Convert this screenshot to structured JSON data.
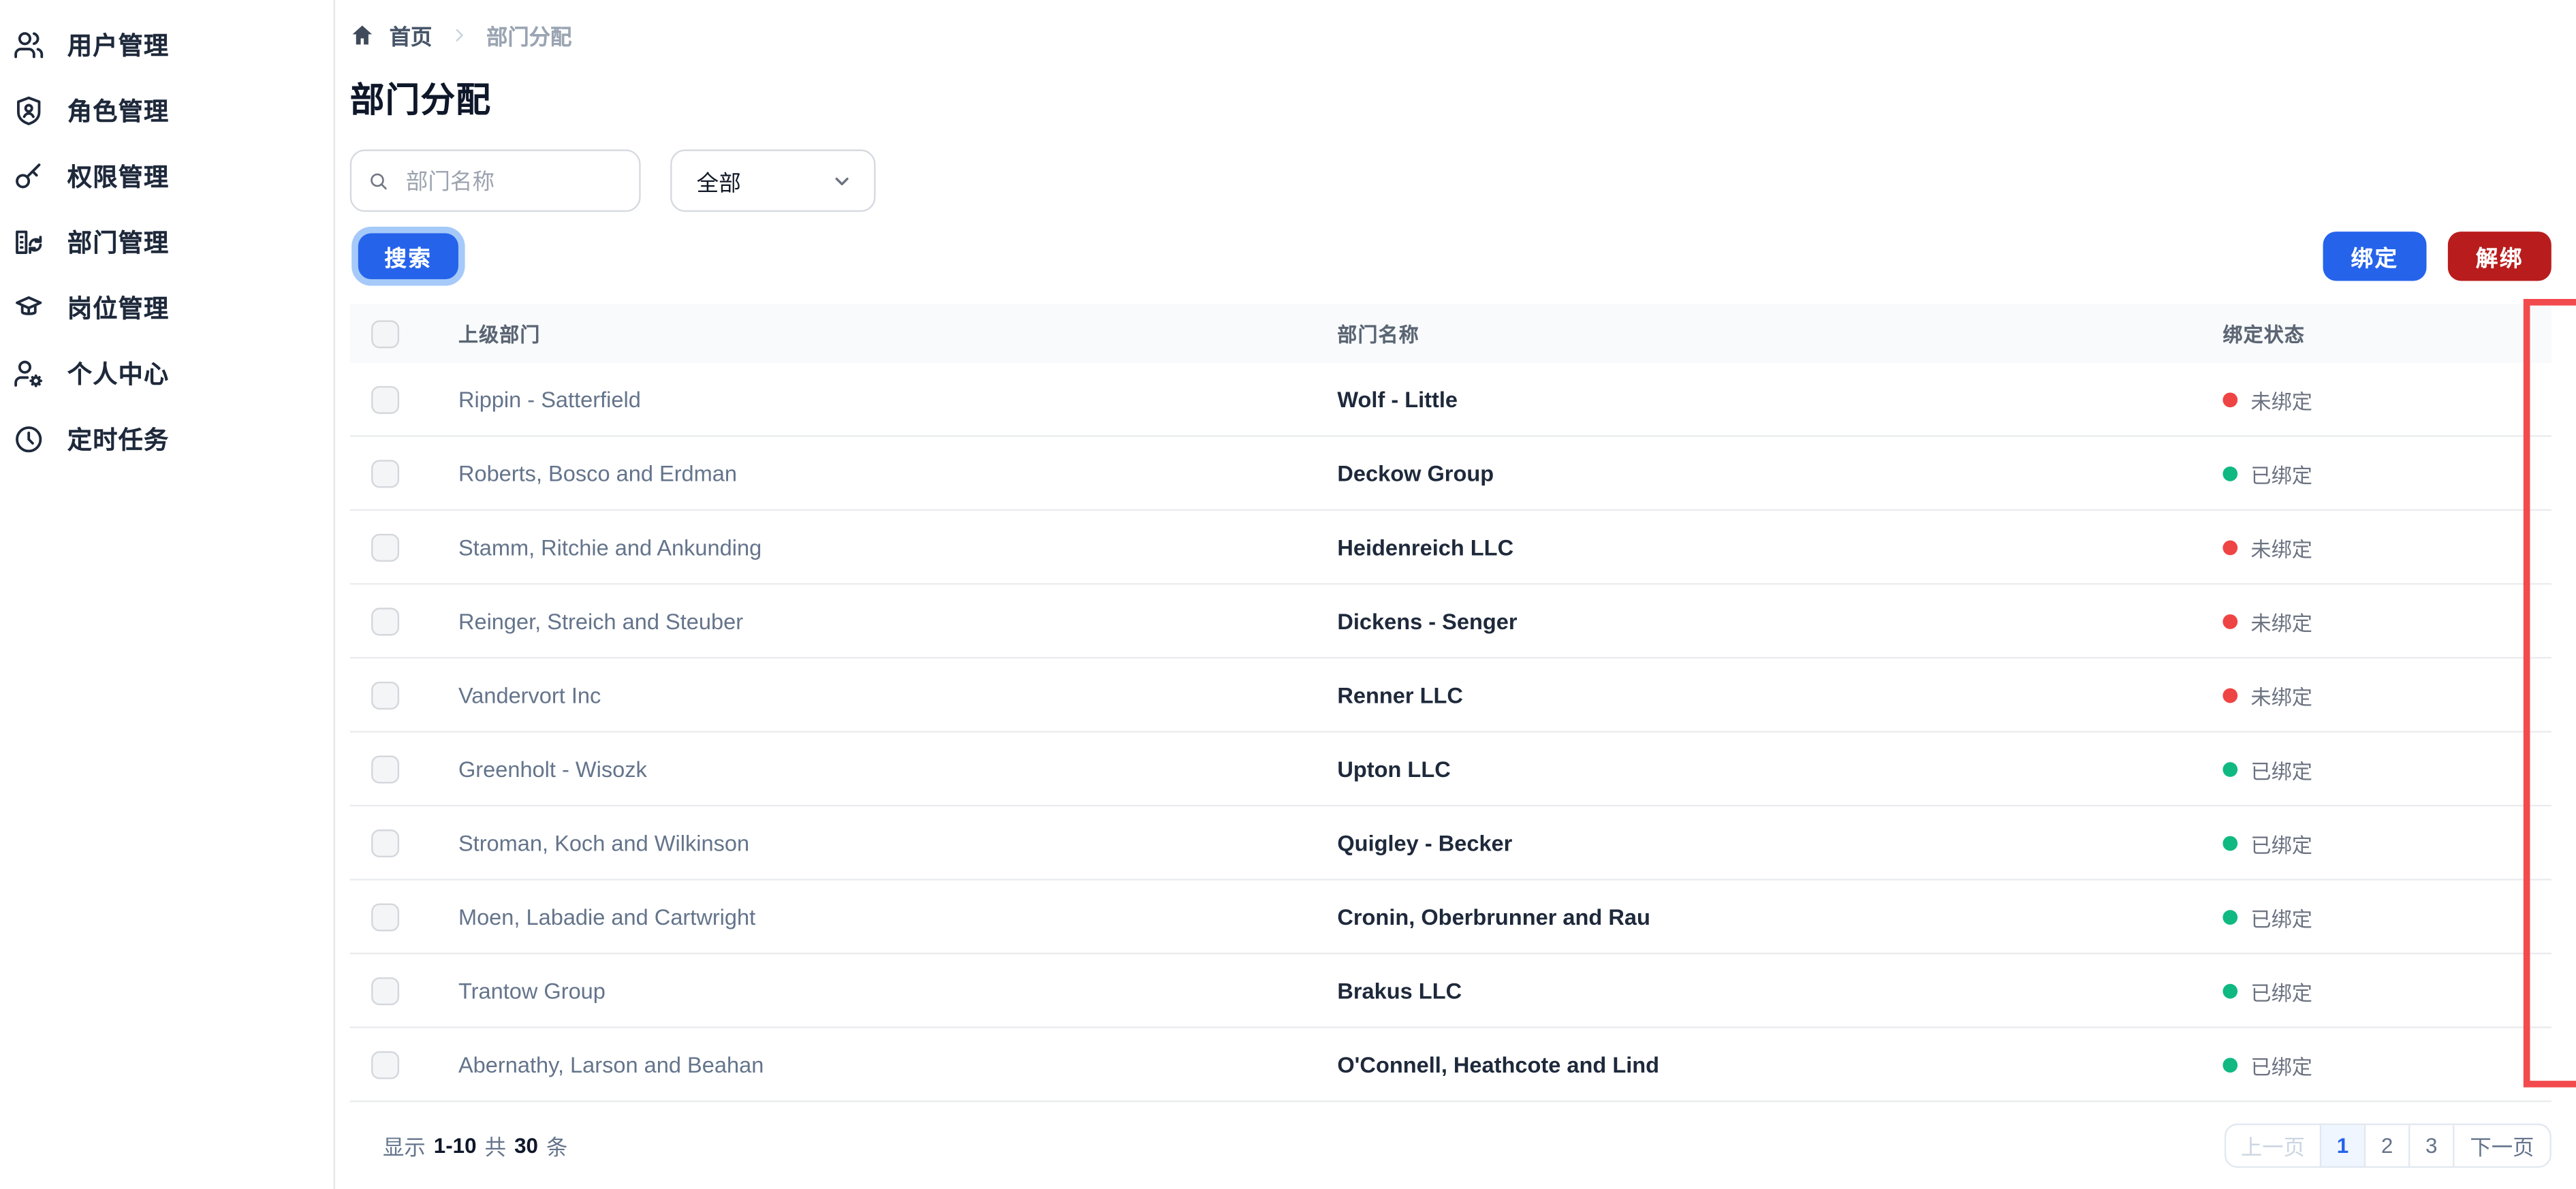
{
  "sidebar": {
    "items": [
      {
        "label": "用户管理",
        "icon": "users-icon"
      },
      {
        "label": "角色管理",
        "icon": "shield-user-icon"
      },
      {
        "label": "权限管理",
        "icon": "key-icon"
      },
      {
        "label": "部门管理",
        "icon": "department-icon"
      },
      {
        "label": "岗位管理",
        "icon": "graduate-icon"
      },
      {
        "label": "个人中心",
        "icon": "user-gear-icon"
      },
      {
        "label": "定时任务",
        "icon": "clock-icon"
      }
    ]
  },
  "breadcrumb": {
    "home": "首页",
    "current": "部门分配"
  },
  "page": {
    "title": "部门分配"
  },
  "filters": {
    "search_placeholder": "部门名称",
    "select_value": "全部",
    "search_button": "搜索"
  },
  "actions": {
    "bind": "绑定",
    "unbind": "解绑"
  },
  "table": {
    "headers": {
      "parent": "上级部门",
      "dept": "部门名称",
      "status": "绑定状态"
    },
    "status_bound": "已绑定",
    "status_unbound": "未绑定",
    "rows": [
      {
        "parent": "Rippin - Satterfield",
        "dept": "Wolf - Little",
        "bound": false
      },
      {
        "parent": "Roberts, Bosco and Erdman",
        "dept": "Deckow Group",
        "bound": true
      },
      {
        "parent": "Stamm, Ritchie and Ankunding",
        "dept": "Heidenreich LLC",
        "bound": false
      },
      {
        "parent": "Reinger, Streich and Steuber",
        "dept": "Dickens - Senger",
        "bound": false
      },
      {
        "parent": "Vandervort Inc",
        "dept": "Renner LLC",
        "bound": false
      },
      {
        "parent": "Greenholt - Wisozk",
        "dept": "Upton LLC",
        "bound": true
      },
      {
        "parent": "Stroman, Koch and Wilkinson",
        "dept": "Quigley - Becker",
        "bound": true
      },
      {
        "parent": "Moen, Labadie and Cartwright",
        "dept": "Cronin, Oberbrunner and Rau",
        "bound": true
      },
      {
        "parent": "Trantow Group",
        "dept": "Brakus LLC",
        "bound": true
      },
      {
        "parent": "Abernathy, Larson and Beahan",
        "dept": "O'Connell, Heathcote and Lind",
        "bound": true
      }
    ]
  },
  "pagination": {
    "summary_prefix": "显示",
    "range": "1-10",
    "total_word": "共",
    "total": "30",
    "unit": "条",
    "prev": "上一页",
    "pages": [
      "1",
      "2",
      "3"
    ],
    "active_page": "1",
    "next": "下一页"
  },
  "colors": {
    "accent": "#2563eb",
    "ring": "#a5c9f9",
    "danger": "#b91c1c",
    "status_green": "#10b981",
    "status_red": "#ef4444",
    "annotation_red": "#f24a4d"
  }
}
